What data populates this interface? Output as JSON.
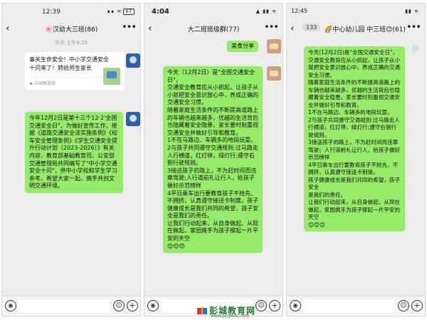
{
  "phone1": {
    "status": {
      "time": "12:39",
      "signal": "∎∎ ≋",
      "battery": "67"
    },
    "title": "汉幼大三班",
    "title_emoji": "🌸",
    "count": "(86)",
    "subtitle": "今天 上午9:29",
    "card": {
      "text": "事关生命安全！中小学交通安全十问来了！转给师生家长",
      "source": "中国教育报"
    },
    "message": "今年12月2日是第十三个12·2'全国交通安全日\"，为做好宣传工作，根据《道路交通安全法实施条例》《校车安全管理条例》《学生交通安全提升行动计划（2023-2026）》有关内容，教育部基础教育司、公安部交通管理局共同编写了\"中小学交通安全十问\"，供中小学校和学生学习参考。希望大家一起，携手共创文明交通环境。"
  },
  "phone2": {
    "status": {
      "time": "4:04",
      "signal": "▲ ▮▮ ≋",
      "battery": ""
    },
    "title": "大二班班级群(77)",
    "short_message": "美食分享",
    "message": "今天（12月2日）是\"全国交通安全日\"，\n交通安全教育应从小抓起，让孩子从小就把安全意识放心中，养成正确的交通安全习惯。\n随着家庭生活条件的不断提高道路上的车辆也越来越多，优越的生活背后也隐藏着安全隐患，家长要时刻重视交通安全并做好引导和教育。\n1不在马路边、车辆多的地段玩耍。\n2与孩子共同遵守交通规则:过马路走人行横道，红灯停，绿灯行;遵守右侧行驶规则。\n3接送孩子的路上，不为赶时间而违章驾驶;人行道前礼让行人，给孩子做好示范榜样\n4平日乘车出行要教育孩子不抢先、不拥挤，认真遵守接送卡制度。孩子健康成长是我们共同的希望，孩子安全是我们的责任。\n让我们行动起来，从自身做起、从现在做起，家园携手为孩子撑起一片平安的天空\n😊😊😊"
  },
  "phone3": {
    "status": {
      "time": "12:45",
      "signal": "▮▮ ≋",
      "battery": ""
    },
    "back_count": "133",
    "title": "🌈中心幼儿园 中三班😊(61)",
    "message": "今天(12月2日)是\"全国交通安全日\"，\n交通安全教育应从小抓起，让孩子从小就把安全意识放心中，养成正确的交通安全习惯。\n随着家庭生活条件的不断提高道路上的车辆也越来越多，优越的生活背后也隐藏着安全隐患，家长要时刻重视交通安全并做好引导和教育。\n1不在马路边、车辆多的地段玩耍。\n2与孩子共同遵守交通规则:过马路走人行横道，红灯停，绿灯行;遵守右侧行驶规则。\n3接送孩子的路上，不为赶时间而违章驾驶；人行道前礼让行人，给孩子做好示范榜样\n4平日乘车出行要教育孩子不抢先、不拥挤，认真遵守接送卡制度。\n孩子健康成长是我们共同的希望，孩子安全\n是我们的责任。\n让我们行动起来，从自身做起、从现在做起，家园携手为孩子撑起一片平安的天空\n😊😊😊"
  },
  "watermark": {
    "name": "彭城教育网",
    "url": "www.pcjyedu.com"
  },
  "colors": {
    "bubble": "#95ec69",
    "background": "#ededed",
    "card": "#ffffff"
  },
  "icons": {
    "voice": "voice-icon",
    "emoji": "emoji-icon",
    "plus": "plus-icon",
    "back": "back-arrow-icon",
    "more": "more-icon"
  }
}
